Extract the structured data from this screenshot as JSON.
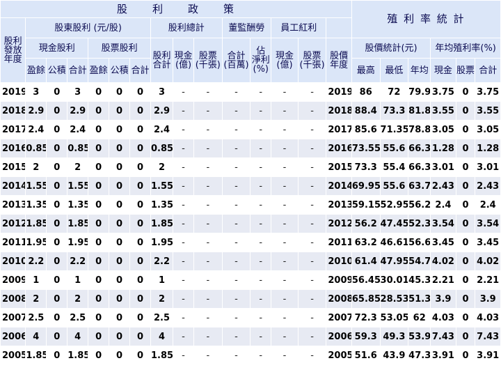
{
  "header": {
    "policy_title": "股　　利　　政　　策",
    "yield_title": "殖 利 率 統 計",
    "dividend_year": "股利\n發放\n年度",
    "shareholder_dividend": "股東股利 (元/股)",
    "dividend_total": "股利總計",
    "director_pay": "董監酬勞",
    "employee_bonus": "員工紅利",
    "cash_dividend": "現金股利",
    "stock_dividend": "股票股利",
    "dividend_sum": "股利\n合計",
    "cash_billion": "現金\n(億)",
    "stock_kshares": "股票\n(千張)",
    "total_million": "合計\n(百萬)",
    "est_net_income": "佔\n淨利\n(%)",
    "emp_cash_billion": "現金\n(億)",
    "emp_stock_kshares": "股票\n(千張)",
    "price_year": "股價\n年度",
    "price_stats": "股價統計(元)",
    "avg_yield": "年均殖利率(%)",
    "earnings": "盈餘",
    "reserve": "公積",
    "subtotal": "合計",
    "high": "最高",
    "low": "最低",
    "avg": "年均",
    "cash": "現金",
    "stock": "股票",
    "total": "合計"
  },
  "rows": [
    {
      "year": "2019",
      "c_earn": "3",
      "c_res": "0",
      "c_sum": "3",
      "s_earn": "0",
      "s_res": "0",
      "s_sum": "0",
      "total": "3",
      "cash_b": "-",
      "stock_k": "-",
      "dir_m": "-",
      "dir_pct": "-",
      "emp_cash": "-",
      "emp_stock": "-",
      "pyear": "2019",
      "high": "86",
      "low": "72",
      "avg": "79.9",
      "y_cash": "3.75",
      "y_stock": "0",
      "y_total": "3.75"
    },
    {
      "year": "2018",
      "c_earn": "2.9",
      "c_res": "0",
      "c_sum": "2.9",
      "s_earn": "0",
      "s_res": "0",
      "s_sum": "0",
      "total": "2.9",
      "cash_b": "-",
      "stock_k": "-",
      "dir_m": "-",
      "dir_pct": "-",
      "emp_cash": "-",
      "emp_stock": "-",
      "pyear": "2018",
      "high": "88.4",
      "low": "73.3",
      "avg": "81.8",
      "y_cash": "3.55",
      "y_stock": "0",
      "y_total": "3.55"
    },
    {
      "year": "2017",
      "c_earn": "2.4",
      "c_res": "0",
      "c_sum": "2.4",
      "s_earn": "0",
      "s_res": "0",
      "s_sum": "0",
      "total": "2.4",
      "cash_b": "-",
      "stock_k": "-",
      "dir_m": "-",
      "dir_pct": "-",
      "emp_cash": "-",
      "emp_stock": "-",
      "pyear": "2017",
      "high": "85.6",
      "low": "71.35",
      "avg": "78.8",
      "y_cash": "3.05",
      "y_stock": "0",
      "y_total": "3.05"
    },
    {
      "year": "2016",
      "c_earn": "0.85",
      "c_res": "0",
      "c_sum": "0.85",
      "s_earn": "0",
      "s_res": "0",
      "s_sum": "0",
      "total": "0.85",
      "cash_b": "-",
      "stock_k": "-",
      "dir_m": "-",
      "dir_pct": "-",
      "emp_cash": "-",
      "emp_stock": "-",
      "pyear": "2016",
      "high": "73.55",
      "low": "55.6",
      "avg": "66.3",
      "y_cash": "1.28",
      "y_stock": "0",
      "y_total": "1.28"
    },
    {
      "year": "2015",
      "c_earn": "2",
      "c_res": "0",
      "c_sum": "2",
      "s_earn": "0",
      "s_res": "0",
      "s_sum": "0",
      "total": "2",
      "cash_b": "-",
      "stock_k": "-",
      "dir_m": "-",
      "dir_pct": "-",
      "emp_cash": "-",
      "emp_stock": "-",
      "pyear": "2015",
      "high": "73.3",
      "low": "55.4",
      "avg": "66.3",
      "y_cash": "3.01",
      "y_stock": "0",
      "y_total": "3.01"
    },
    {
      "year": "2014",
      "c_earn": "1.55",
      "c_res": "0",
      "c_sum": "1.55",
      "s_earn": "0",
      "s_res": "0",
      "s_sum": "0",
      "total": "1.55",
      "cash_b": "-",
      "stock_k": "-",
      "dir_m": "-",
      "dir_pct": "-",
      "emp_cash": "-",
      "emp_stock": "-",
      "pyear": "2014",
      "high": "69.95",
      "low": "55.6",
      "avg": "63.7",
      "y_cash": "2.43",
      "y_stock": "0",
      "y_total": "2.43"
    },
    {
      "year": "2013",
      "c_earn": "1.35",
      "c_res": "0",
      "c_sum": "1.35",
      "s_earn": "0",
      "s_res": "0",
      "s_sum": "0",
      "total": "1.35",
      "cash_b": "-",
      "stock_k": "-",
      "dir_m": "-",
      "dir_pct": "-",
      "emp_cash": "-",
      "emp_stock": "-",
      "pyear": "2013",
      "high": "59.15",
      "low": "52.95",
      "avg": "56.2",
      "y_cash": "2.4",
      "y_stock": "0",
      "y_total": "2.4"
    },
    {
      "year": "2012",
      "c_earn": "1.85",
      "c_res": "0",
      "c_sum": "1.85",
      "s_earn": "0",
      "s_res": "0",
      "s_sum": "0",
      "total": "1.85",
      "cash_b": "-",
      "stock_k": "-",
      "dir_m": "-",
      "dir_pct": "-",
      "emp_cash": "-",
      "emp_stock": "-",
      "pyear": "2012",
      "high": "56.2",
      "low": "47.45",
      "avg": "52.3",
      "y_cash": "3.54",
      "y_stock": "0",
      "y_total": "3.54"
    },
    {
      "year": "2011",
      "c_earn": "1.95",
      "c_res": "0",
      "c_sum": "1.95",
      "s_earn": "0",
      "s_res": "0",
      "s_sum": "0",
      "total": "1.95",
      "cash_b": "-",
      "stock_k": "-",
      "dir_m": "-",
      "dir_pct": "-",
      "emp_cash": "-",
      "emp_stock": "-",
      "pyear": "2011",
      "high": "63.2",
      "low": "46.61",
      "avg": "56.6",
      "y_cash": "3.45",
      "y_stock": "0",
      "y_total": "3.45"
    },
    {
      "year": "2010",
      "c_earn": "2.2",
      "c_res": "0",
      "c_sum": "2.2",
      "s_earn": "0",
      "s_res": "0",
      "s_sum": "0",
      "total": "2.2",
      "cash_b": "-",
      "stock_k": "-",
      "dir_m": "-",
      "dir_pct": "-",
      "emp_cash": "-",
      "emp_stock": "-",
      "pyear": "2010",
      "high": "61.4",
      "low": "47.95",
      "avg": "54.7",
      "y_cash": "4.02",
      "y_stock": "0",
      "y_total": "4.02"
    },
    {
      "year": "2009",
      "c_earn": "1",
      "c_res": "0",
      "c_sum": "1",
      "s_earn": "0",
      "s_res": "0",
      "s_sum": "0",
      "total": "1",
      "cash_b": "-",
      "stock_k": "-",
      "dir_m": "-",
      "dir_pct": "-",
      "emp_cash": "-",
      "emp_stock": "-",
      "pyear": "2009",
      "high": "56.45",
      "low": "30.01",
      "avg": "45.3",
      "y_cash": "2.21",
      "y_stock": "0",
      "y_total": "2.21"
    },
    {
      "year": "2008",
      "c_earn": "2",
      "c_res": "0",
      "c_sum": "2",
      "s_earn": "0",
      "s_res": "0",
      "s_sum": "0",
      "total": "2",
      "cash_b": "-",
      "stock_k": "-",
      "dir_m": "-",
      "dir_pct": "-",
      "emp_cash": "-",
      "emp_stock": "-",
      "pyear": "2008",
      "high": "65.85",
      "low": "28.53",
      "avg": "51.3",
      "y_cash": "3.9",
      "y_stock": "0",
      "y_total": "3.9"
    },
    {
      "year": "2007",
      "c_earn": "2.5",
      "c_res": "0",
      "c_sum": "2.5",
      "s_earn": "0",
      "s_res": "0",
      "s_sum": "0",
      "total": "2.5",
      "cash_b": "-",
      "stock_k": "-",
      "dir_m": "-",
      "dir_pct": "-",
      "emp_cash": "-",
      "emp_stock": "-",
      "pyear": "2007",
      "high": "72.3",
      "low": "53.05",
      "avg": "62",
      "y_cash": "4.03",
      "y_stock": "0",
      "y_total": "4.03"
    },
    {
      "year": "2006",
      "c_earn": "4",
      "c_res": "0",
      "c_sum": "4",
      "s_earn": "0",
      "s_res": "0",
      "s_sum": "0",
      "total": "4",
      "cash_b": "-",
      "stock_k": "-",
      "dir_m": "-",
      "dir_pct": "-",
      "emp_cash": "-",
      "emp_stock": "-",
      "pyear": "2006",
      "high": "59.3",
      "low": "49.3",
      "avg": "53.9",
      "y_cash": "7.43",
      "y_stock": "0",
      "y_total": "7.43"
    },
    {
      "year": "2005",
      "c_earn": "1.85",
      "c_res": "0",
      "c_sum": "1.85",
      "s_earn": "0",
      "s_res": "0",
      "s_sum": "0",
      "total": "1.85",
      "cash_b": "-",
      "stock_k": "-",
      "dir_m": "-",
      "dir_pct": "-",
      "emp_cash": "-",
      "emp_stock": "-",
      "pyear": "2005",
      "high": "51.6",
      "low": "43.9",
      "avg": "47.3",
      "y_cash": "3.91",
      "y_stock": "0",
      "y_total": "3.91"
    }
  ]
}
